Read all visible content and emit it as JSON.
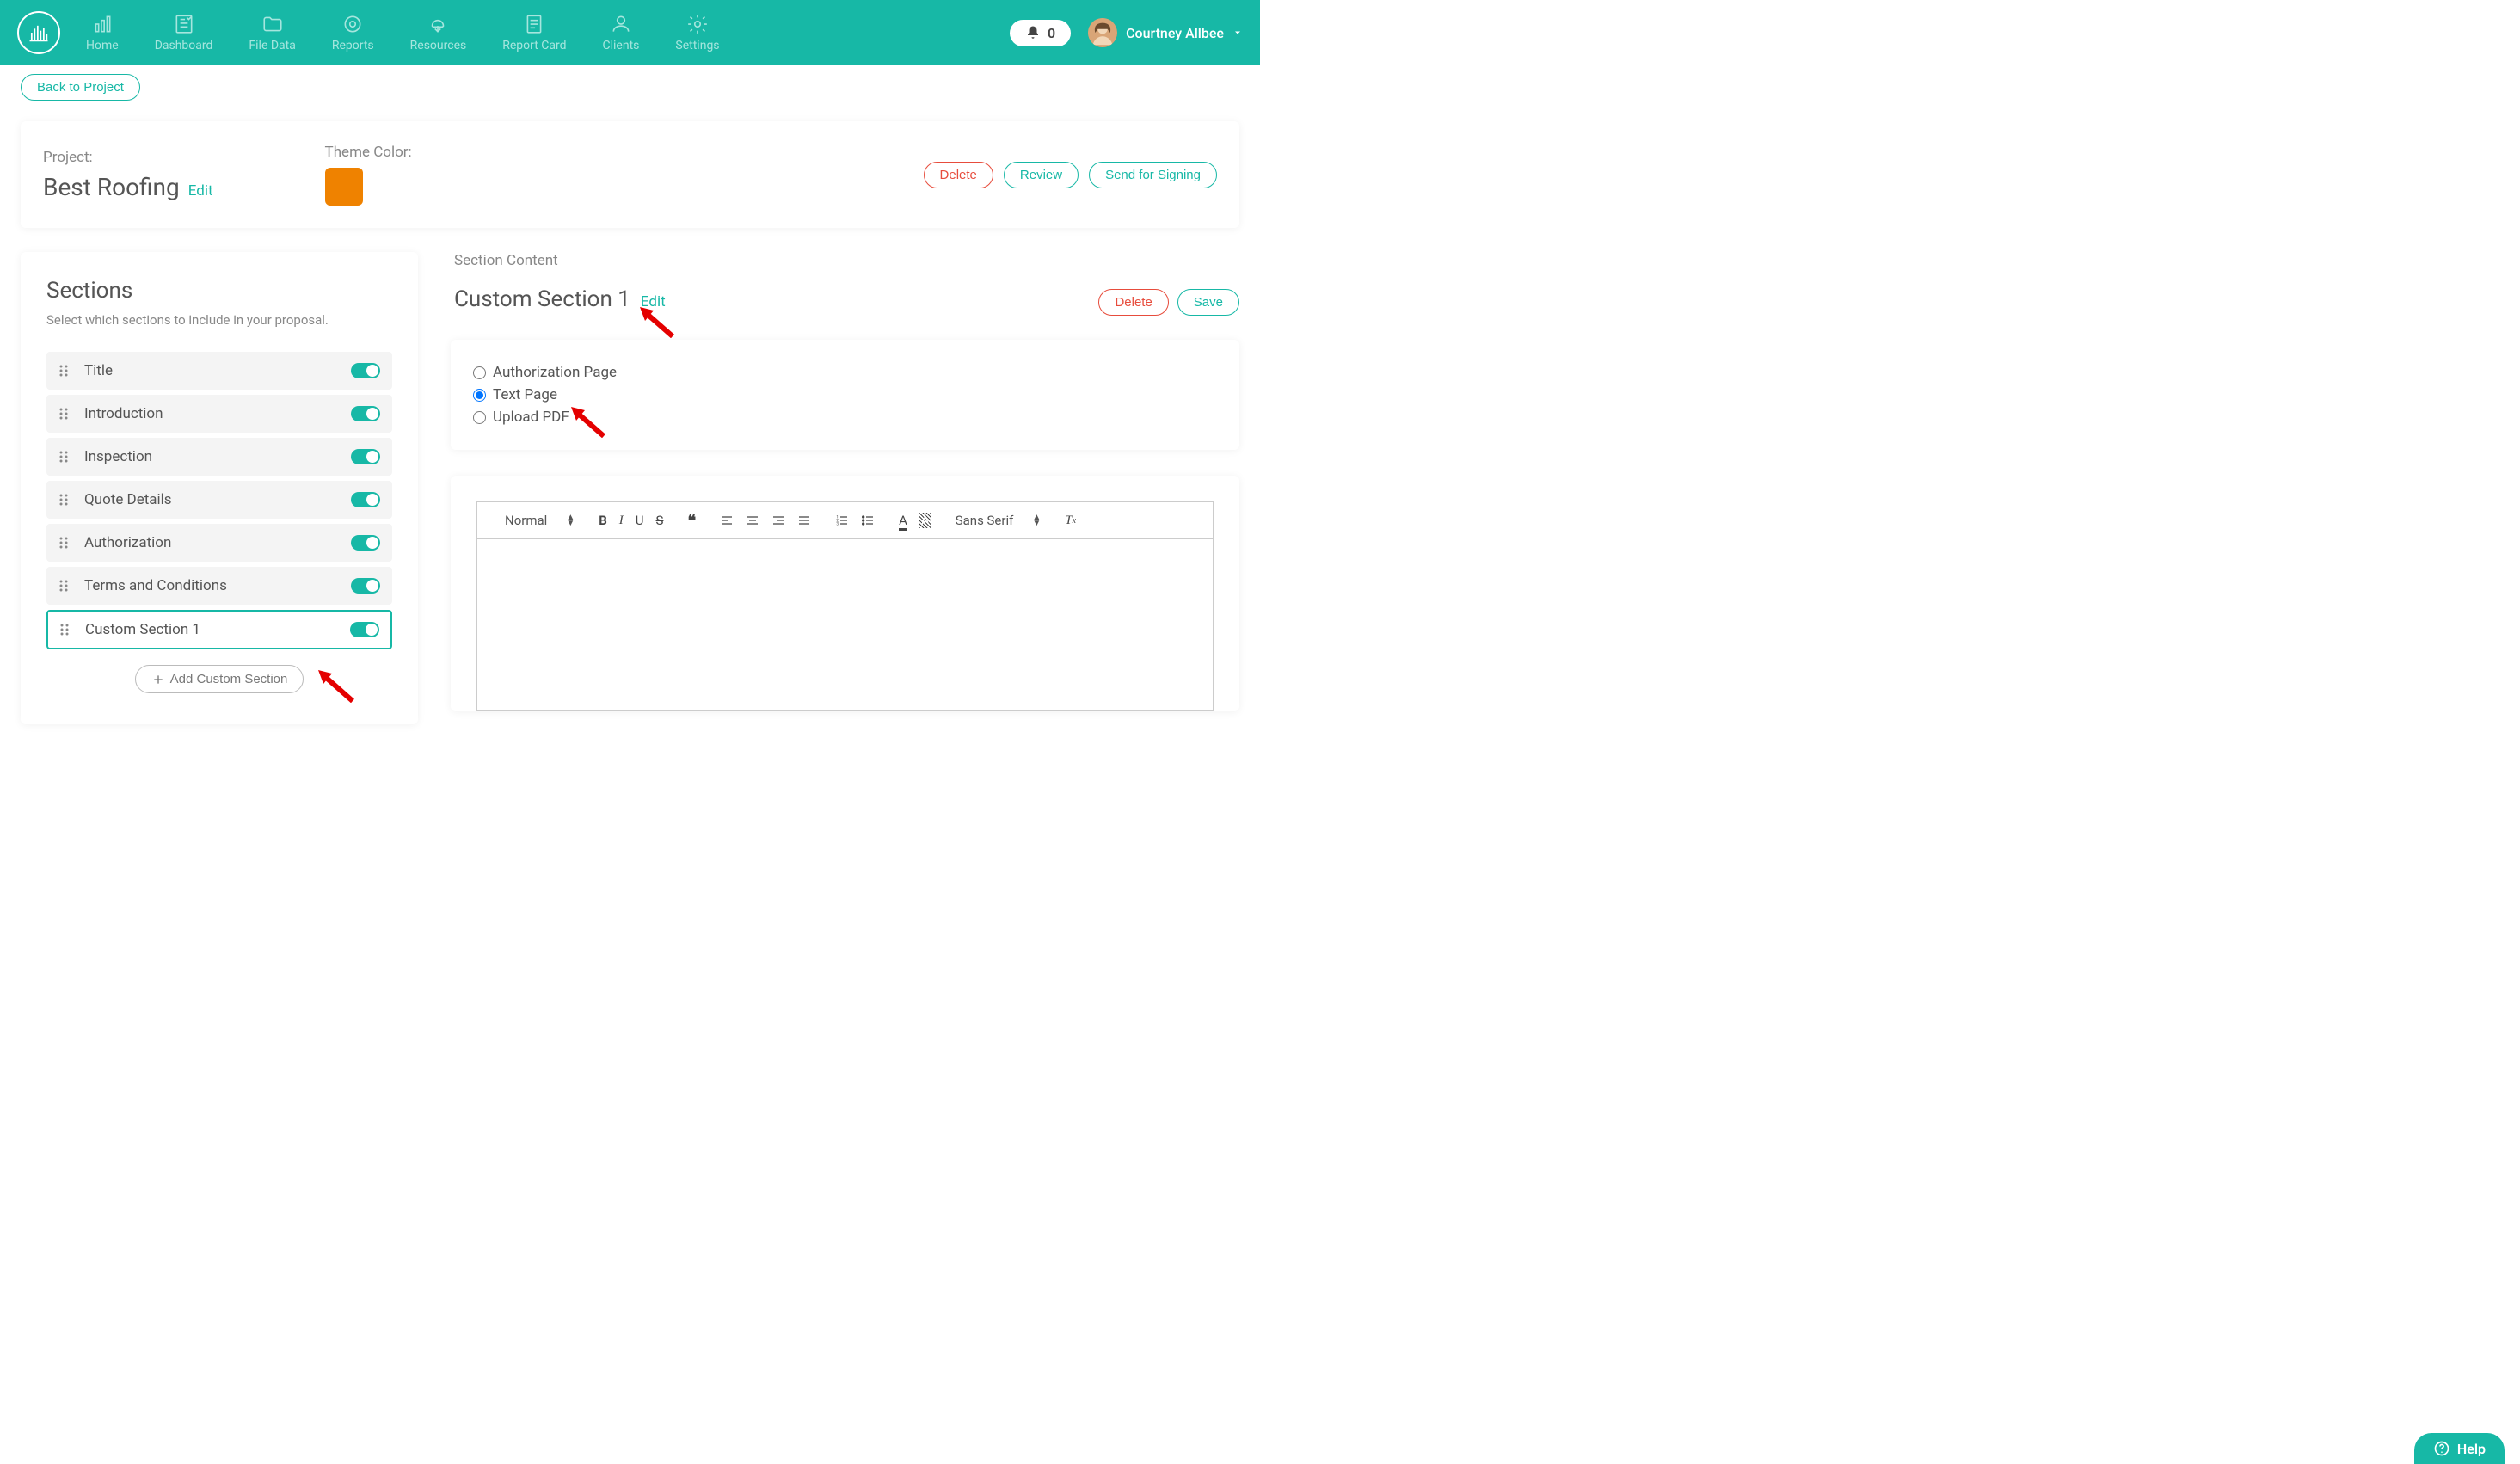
{
  "nav": {
    "items": [
      "Home",
      "Dashboard",
      "File Data",
      "Reports",
      "Resources",
      "Report Card",
      "Clients",
      "Settings"
    ],
    "notifications": "0",
    "user_name": "Courtney Allbee"
  },
  "back_button": "Back to Project",
  "project": {
    "label": "Project:",
    "name": "Best Roofing",
    "edit": "Edit",
    "theme_label": "Theme Color:",
    "theme_color": "#ef8200",
    "actions": {
      "delete": "Delete",
      "review": "Review",
      "send": "Send for Signing"
    }
  },
  "sections": {
    "title": "Sections",
    "subtitle": "Select which sections to include in your proposal.",
    "items": [
      {
        "label": "Title",
        "on": true,
        "selected": false
      },
      {
        "label": "Introduction",
        "on": true,
        "selected": false
      },
      {
        "label": "Inspection",
        "on": true,
        "selected": false
      },
      {
        "label": "Quote Details",
        "on": true,
        "selected": false
      },
      {
        "label": "Authorization",
        "on": true,
        "selected": false
      },
      {
        "label": "Terms and Conditions",
        "on": true,
        "selected": false
      },
      {
        "label": "Custom Section 1",
        "on": true,
        "selected": true
      }
    ],
    "add_label": "Add Custom Section"
  },
  "content": {
    "header_label": "Section Content",
    "title": "Custom Section 1",
    "edit": "Edit",
    "delete": "Delete",
    "save": "Save",
    "radios": [
      {
        "label": "Authorization Page",
        "checked": false
      },
      {
        "label": "Text Page",
        "checked": true
      },
      {
        "label": "Upload PDF",
        "checked": false
      }
    ],
    "toolbar": {
      "format": "Normal",
      "font": "Sans Serif"
    }
  },
  "help": "Help"
}
